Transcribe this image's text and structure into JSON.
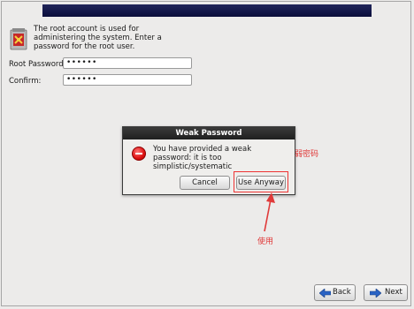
{
  "installer": {
    "intro_text": "The root account is used for administering the system.  Enter a password for the root user.",
    "root_password_label": "Root Password:",
    "root_password_value": "••••••",
    "confirm_label": "Confirm:",
    "confirm_value": "••••••"
  },
  "dialog": {
    "title": "Weak Password",
    "message": "You have provided a weak password: it is too simplistic/systematic",
    "cancel_label": "Cancel",
    "use_anyway_label": "Use Anyway",
    "icon": "error-icon"
  },
  "annotations": {
    "weak_password_note": "弱密码",
    "use_note": "使用",
    "color": "#e03a3a"
  },
  "nav": {
    "back_label": "Back",
    "next_label": "Next"
  },
  "colors": {
    "banner": "#121648",
    "accent_blue": "#1f5fbf"
  }
}
